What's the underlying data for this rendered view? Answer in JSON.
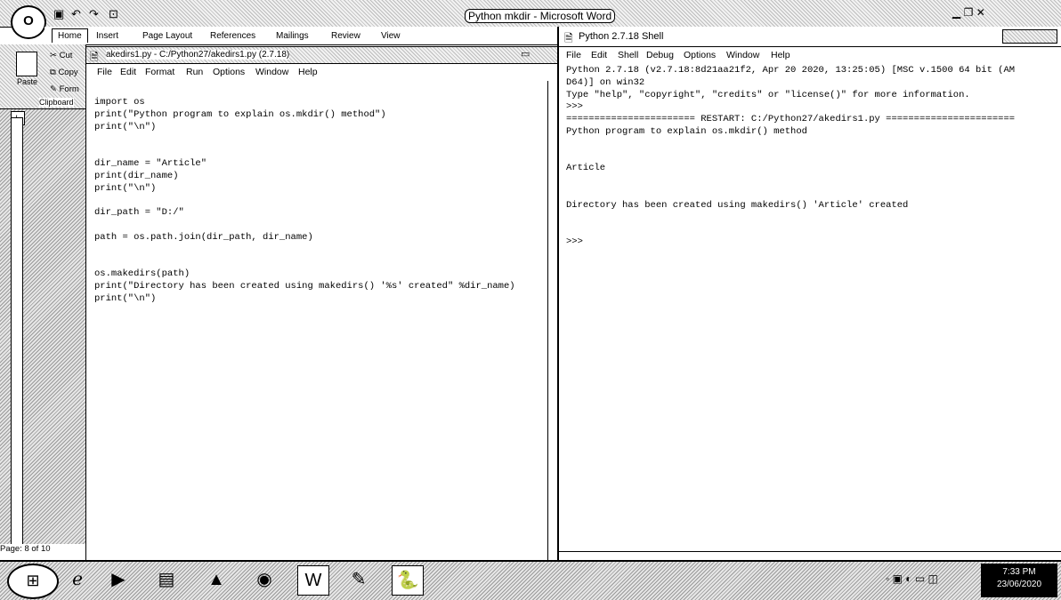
{
  "word": {
    "title": "Python mkdir - Microsoft Word",
    "office_button": "O",
    "tabs": [
      "Home",
      "Insert",
      "Page Layout",
      "References",
      "Mailings",
      "Review",
      "View"
    ],
    "clipboard": {
      "cut": "Cut",
      "copy": "Copy",
      "format": "Form",
      "paste": "Paste",
      "group": "Clipboard"
    },
    "status": "Page: 8 of 10"
  },
  "editor": {
    "title": "akedirs1.py - C:/Python27/akedirs1.py (2.7.18)",
    "menu": [
      "File",
      "Edit",
      "Format",
      "Run",
      "Options",
      "Window",
      "Help"
    ],
    "code": [
      "import os",
      "print(\"Python program to explain os.mkdir() method\")",
      "print(\"\\n\")",
      "",
      "",
      "dir_name = \"Article\"",
      "print(dir_name)",
      "print(\"\\n\")",
      "",
      "dir_path = \"D:/\"",
      "",
      "path = os.path.join(dir_path, dir_name)",
      "",
      "",
      "os.makedirs(path)",
      "print(\"Directory has been created using makedirs() '%s' created\" %dir_name)",
      "print(\"\\n\")"
    ]
  },
  "shell": {
    "title": "Python 2.7.18 Shell",
    "menu": [
      "File",
      "Edit",
      "Shell",
      "Debug",
      "Options",
      "Window",
      "Help"
    ],
    "output": [
      "Python 2.7.18 (v2.7.18:8d21aa21f2, Apr 20 2020, 13:25:05) [MSC v.1500 64 bit (AM",
      "D64)] on win32",
      "Type \"help\", \"copyright\", \"credits\" or \"license()\" for more information.",
      ">>>",
      "======================= RESTART: C:/Python27/akedirs1.py =======================",
      "Python program to explain os.mkdir() method",
      "",
      "",
      "Article",
      "",
      "",
      "Directory has been created using makedirs() 'Article' created",
      "",
      "",
      ">>>"
    ]
  },
  "taskbar": {
    "time": "7:33 PM",
    "date": "23/06/2020"
  }
}
